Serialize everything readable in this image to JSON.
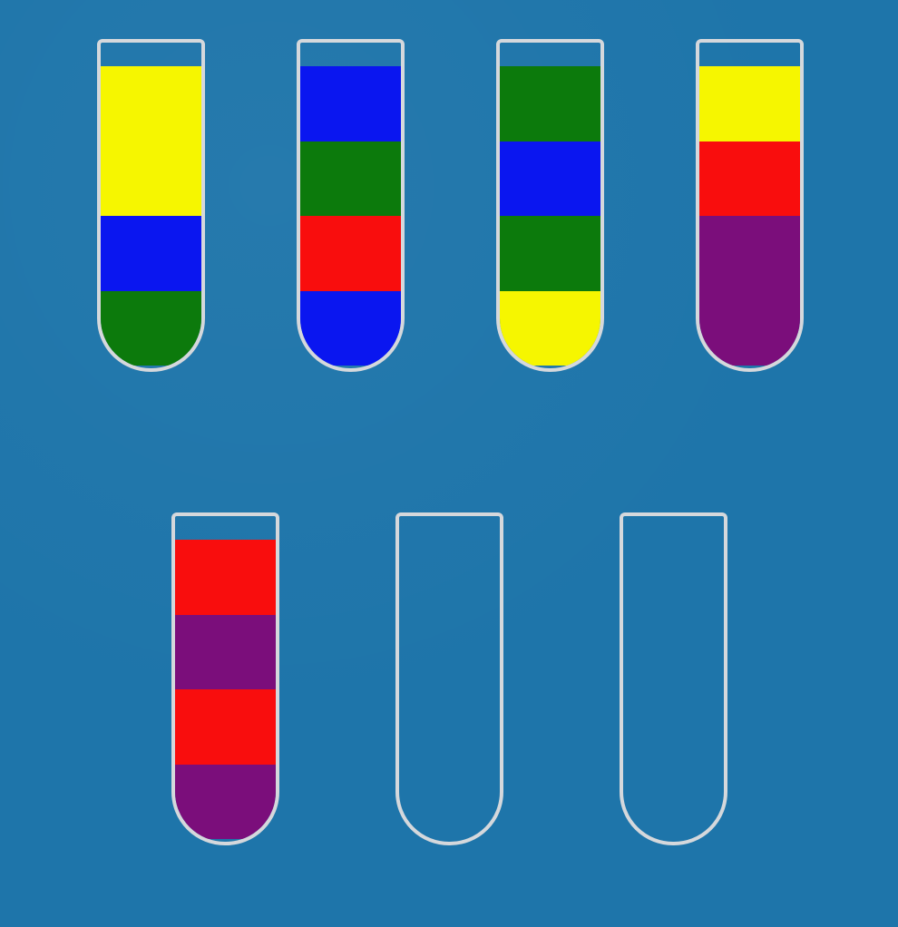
{
  "game": {
    "capacity": 4,
    "colors": {
      "yellow": "#f6f600",
      "blue": "#0a16f0",
      "green": "#0c7a0c",
      "red": "#f90d0d",
      "purple": "#7b0e7b"
    },
    "background_color": "#1e75aa",
    "tube_border_color": "#d5d8dc",
    "tubes": [
      {
        "id": 1,
        "segments_top_to_bottom": [
          "yellow",
          "yellow",
          "blue",
          "green"
        ]
      },
      {
        "id": 2,
        "segments_top_to_bottom": [
          "blue",
          "green",
          "red",
          "blue"
        ]
      },
      {
        "id": 3,
        "segments_top_to_bottom": [
          "green",
          "blue",
          "green",
          "yellow"
        ]
      },
      {
        "id": 4,
        "segments_top_to_bottom": [
          "yellow",
          "red",
          "purple",
          "purple"
        ]
      },
      {
        "id": 5,
        "segments_top_to_bottom": [
          "red",
          "purple",
          "red",
          "purple"
        ]
      },
      {
        "id": 6,
        "segments_top_to_bottom": []
      },
      {
        "id": 7,
        "segments_top_to_bottom": []
      }
    ]
  }
}
